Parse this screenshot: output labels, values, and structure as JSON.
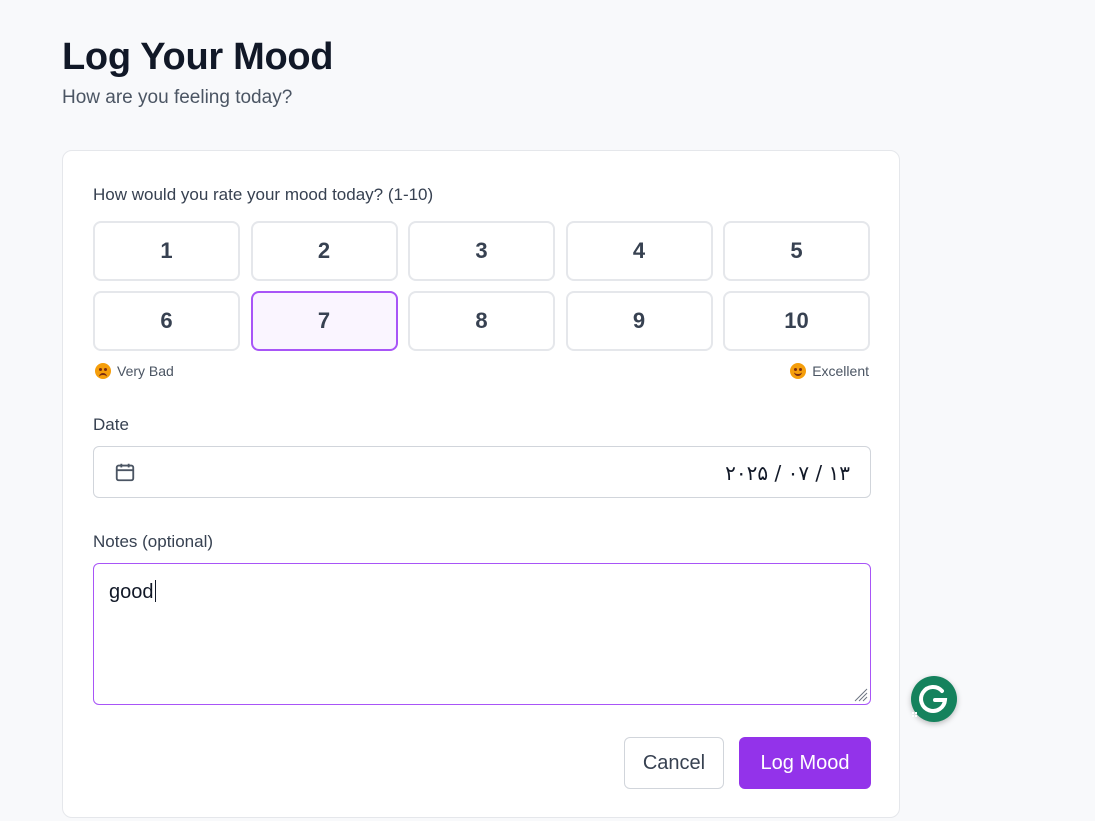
{
  "header": {
    "title": "Log Your Mood",
    "subtitle": "How are you feeling today?"
  },
  "form": {
    "rating": {
      "label": "How would you rate your mood today? (1-10)",
      "options": [
        "1",
        "2",
        "3",
        "4",
        "5",
        "6",
        "7",
        "8",
        "9",
        "10"
      ],
      "selected": "7",
      "low_label": "Very Bad",
      "high_label": "Excellent",
      "low_icon": "flushed-face-icon",
      "high_icon": "smiling-face-icon"
    },
    "date": {
      "label": "Date",
      "value": "۲۰۲۵ / ۰۷ / ۱۳",
      "icon": "calendar-icon"
    },
    "notes": {
      "label": "Notes (optional)",
      "value": "good"
    },
    "actions": {
      "cancel_label": "Cancel",
      "submit_label": "Log Mood"
    }
  },
  "colors": {
    "accent": "#9333ea",
    "selected_border": "#a855f7",
    "selected_bg": "#faf5ff",
    "grammarly": "#15825d"
  },
  "extensions": {
    "grammarly_icon": "grammarly-icon"
  }
}
